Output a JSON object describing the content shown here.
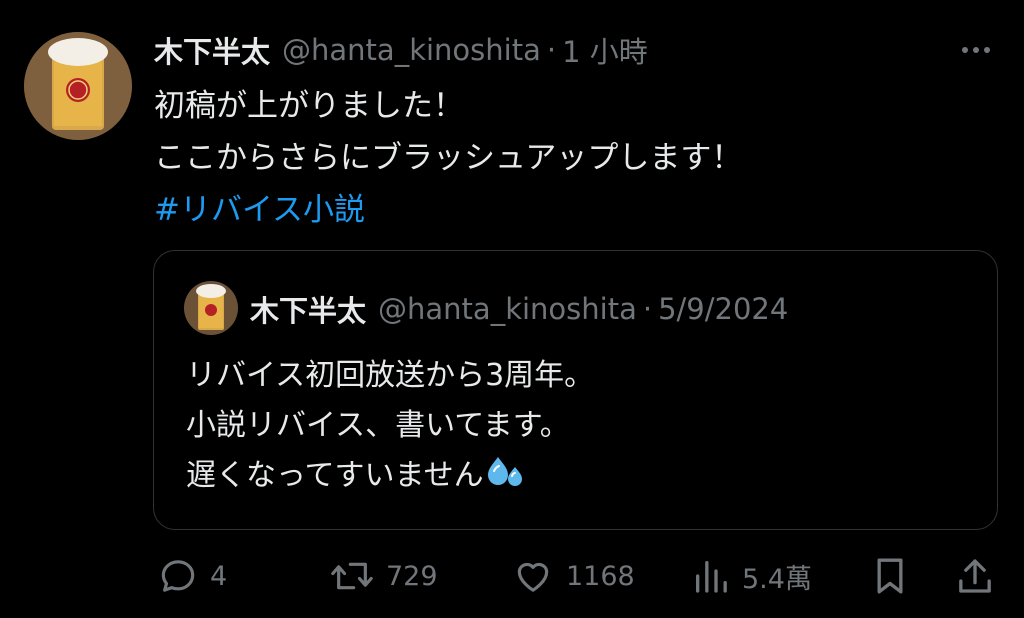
{
  "tweet": {
    "author_name": "木下半太",
    "handle": "@hanta_kinoshita",
    "separator": "·",
    "time": "1 小時",
    "text_lines": [
      "初稿が上がりました！",
      "ここからさらにブラッシュアップします！"
    ],
    "hashtag": "#リバイス小説",
    "more_icon": "more-horizontal-icon"
  },
  "quote": {
    "author_name": "木下半太",
    "handle": "@hanta_kinoshita",
    "separator": "·",
    "date": "5/9/2024",
    "text_lines": [
      "リバイス初回放送から3周年。",
      "小説リバイス、書いてます。",
      "遅くなってすいません"
    ],
    "emoji": "sweat-droplets-icon"
  },
  "actions": {
    "replies": "4",
    "retweets": "729",
    "likes": "1168",
    "views": "5.4萬",
    "reply_icon": "reply-icon",
    "retweet_icon": "retweet-icon",
    "like_icon": "heart-icon",
    "views_icon": "views-chart-icon",
    "bookmark_icon": "bookmark-icon",
    "share_icon": "share-icon"
  },
  "colors": {
    "background": "#000000",
    "text": "#e7e9ea",
    "muted": "#71767b",
    "link": "#1d9bf0",
    "border": "#2f3336"
  }
}
